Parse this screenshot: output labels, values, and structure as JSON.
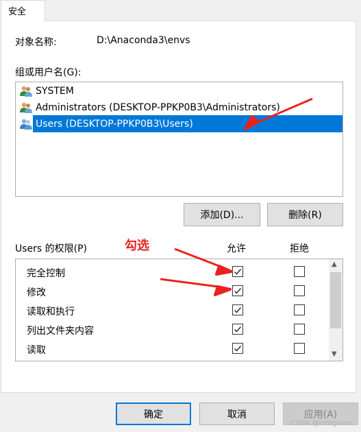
{
  "tab": {
    "label": "安全"
  },
  "object": {
    "label": "对象名称:",
    "value": "D:\\Anaconda3\\envs"
  },
  "groups": {
    "label": "组或用户名(G):",
    "items": [
      {
        "name": "SYSTEM"
      },
      {
        "name": "Administrators (DESKTOP-PPKP0B3\\Administrators)"
      },
      {
        "name": "Users (DESKTOP-PPKP0B3\\Users)",
        "selected": true
      }
    ],
    "add_label": "添加(D)...",
    "remove_label": "删除(R)"
  },
  "permissions": {
    "label": "Users 的权限(P)",
    "allow_header": "允许",
    "deny_header": "拒绝",
    "rows": [
      {
        "name": "完全控制",
        "allow": true,
        "deny": false
      },
      {
        "name": "修改",
        "allow": true,
        "deny": false
      },
      {
        "name": "读取和执行",
        "allow": true,
        "deny": false
      },
      {
        "name": "列出文件夹内容",
        "allow": true,
        "deny": false
      },
      {
        "name": "读取",
        "allow": true,
        "deny": false
      }
    ]
  },
  "annotation": {
    "text": "勾选",
    "color": "#e8231e"
  },
  "footer": {
    "ok": "确定",
    "cancel": "取消",
    "apply": "应用(A)"
  },
  "watermark": "CSDN @birdgoase",
  "colors": {
    "accent": "#0078d7",
    "annotation": "#e8231e"
  }
}
